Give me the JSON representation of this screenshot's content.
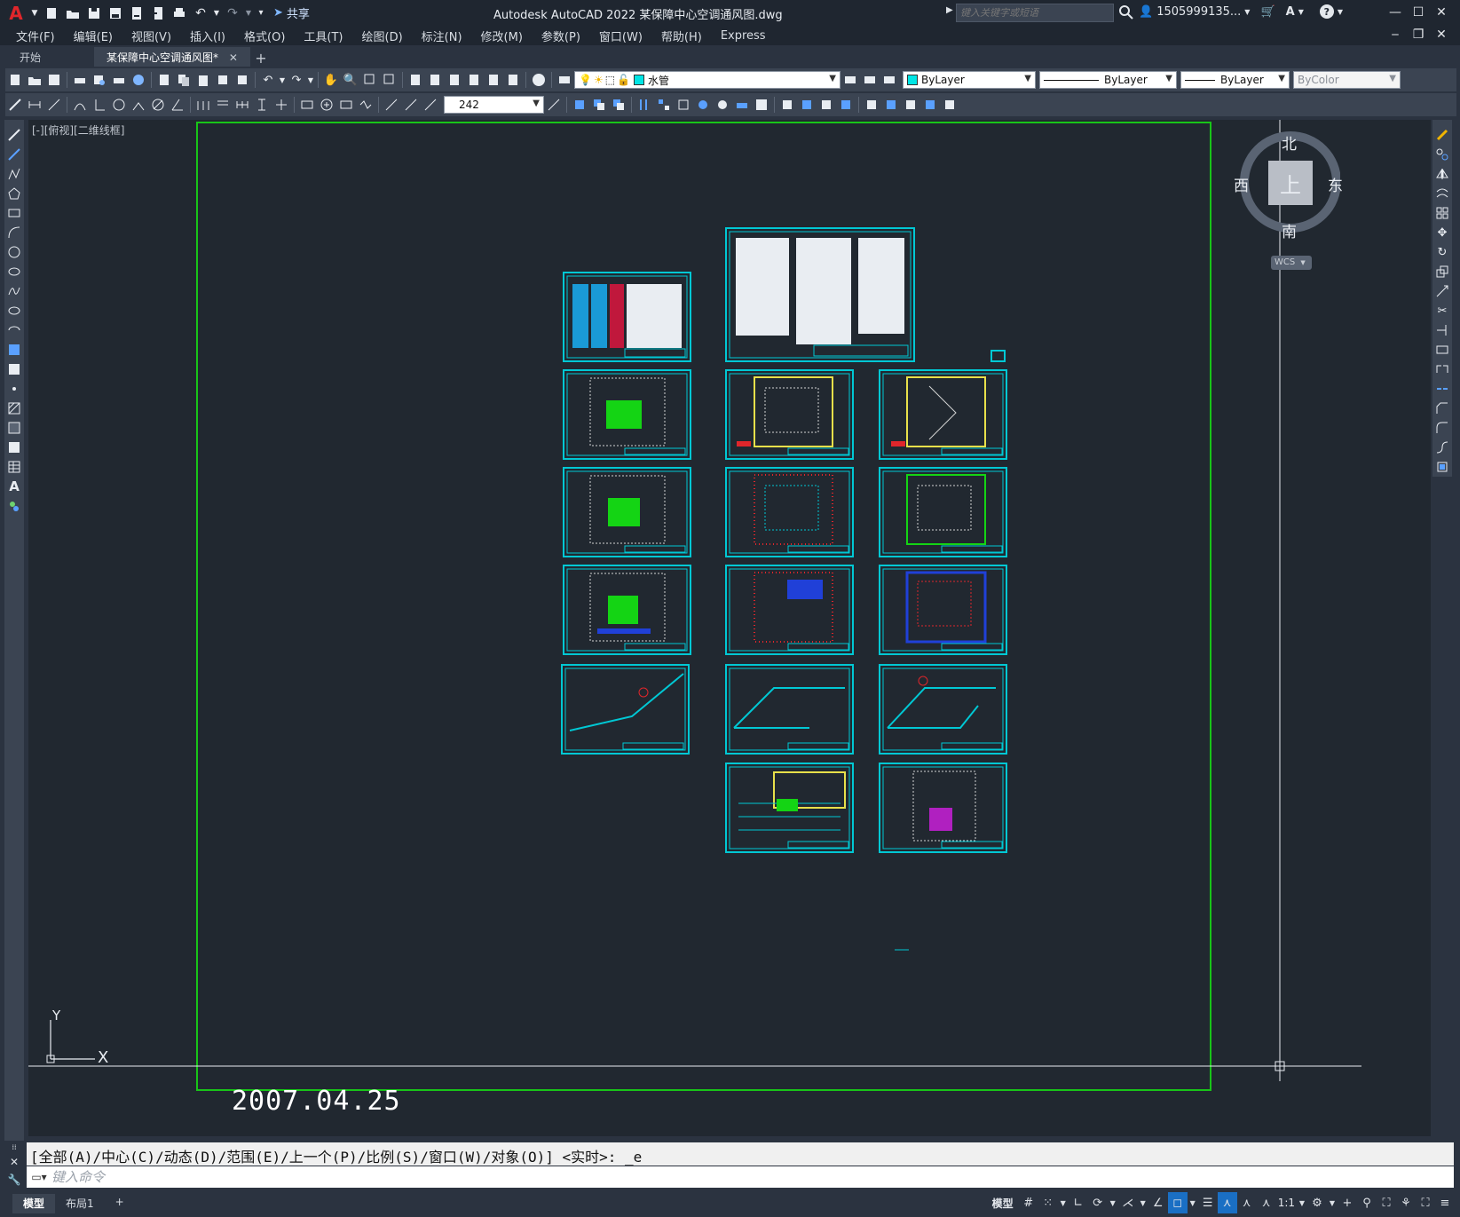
{
  "titlebar": {
    "title": "Autodesk AutoCAD 2022    某保障中心空调通风图.dwg",
    "share": "共享",
    "search_placeholder": "键入关键字或短语",
    "user": "1505999135...",
    "logo": "A"
  },
  "menu": [
    "文件(F)",
    "编辑(E)",
    "视图(V)",
    "插入(I)",
    "格式(O)",
    "工具(T)",
    "绘图(D)",
    "标注(N)",
    "修改(M)",
    "参数(P)",
    "窗口(W)",
    "帮助(H)",
    "Express"
  ],
  "tabs": {
    "start": "开始",
    "active": "某保障中心空调通风图*"
  },
  "toolbar": {
    "layer_name": "水管",
    "layer_color": "#00e5e5",
    "color_value": "ByLayer",
    "linetype_value": "ByLayer",
    "lineweight_value": "ByLayer",
    "plotstyle_value": "ByColor",
    "dim_value": "242"
  },
  "viewport": {
    "label": "[-][俯视][二维线框]",
    "compass": {
      "north": "北",
      "south": "南",
      "east": "东",
      "west": "西",
      "top": "上",
      "wcs": "WCS"
    },
    "ucs_y": "Y",
    "ucs_x": "X",
    "date": "2007.04.25"
  },
  "colors": {
    "sheet_border": "#00c8d4",
    "page_border": "#18c418",
    "canvas_bg": "#212830"
  },
  "command": {
    "history": "[全部(A)/中心(C)/动态(D)/范围(E)/上一个(P)/比例(S)/窗口(W)/对象(O)] <实时>: _e",
    "placeholder": "键入命令"
  },
  "status": {
    "layout_tabs": [
      "模型",
      "布局1"
    ],
    "model_label": "模型",
    "scale": "1:1"
  }
}
